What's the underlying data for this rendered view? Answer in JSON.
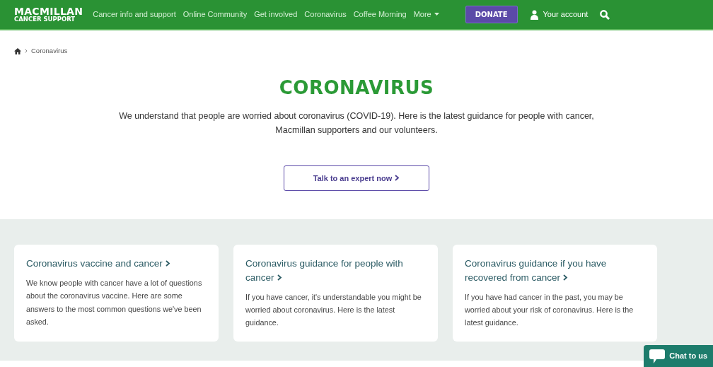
{
  "header": {
    "logo": {
      "line1": "MACMILLAN",
      "line2": "CANCER SUPPORT"
    },
    "nav": [
      {
        "label": "Cancer info and support",
        "dropdown": false
      },
      {
        "label": "Online Community",
        "dropdown": false
      },
      {
        "label": "Get involved",
        "dropdown": false
      },
      {
        "label": "Coronavirus",
        "dropdown": false
      },
      {
        "label": "Coffee Morning",
        "dropdown": false
      },
      {
        "label": "More",
        "dropdown": true
      }
    ],
    "donate": "DONATE",
    "account": "Your account"
  },
  "breadcrumb": [
    "Coronavirus"
  ],
  "heading": "CORONAVIRUS",
  "intro": "We understand that people are worried about coronavirus (COVID-19). Here is the latest guidance for people with cancer, Macmillan supporters and our volunteers.",
  "cta": "Talk to an expert now",
  "cards": [
    {
      "title": "Coronavirus vaccine and cancer",
      "text": "We know people with cancer have a lot of questions about the coronavirus vaccine. Here are some answers to the most common questions we've been asked."
    },
    {
      "title": "Coronavirus guidance for people with cancer",
      "text": "If you have cancer, it's understandable you might be worried about coronavirus. Here is the latest guidance."
    },
    {
      "title": "Coronavirus guidance if you have recovered from cancer",
      "text": "If you have had cancer in the past, you may be worried about your risk of coronavirus. Here is the latest guidance."
    }
  ],
  "chat": "Chat to us"
}
